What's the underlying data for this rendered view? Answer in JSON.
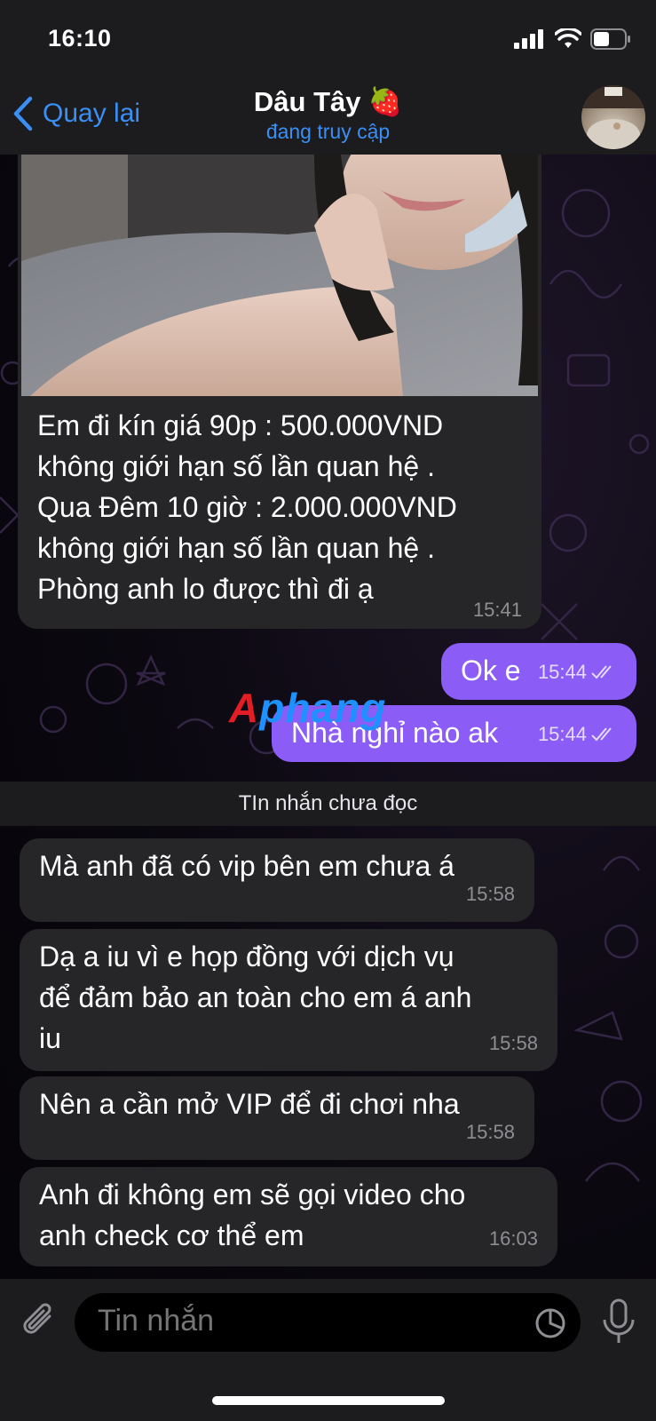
{
  "status_bar": {
    "time": "16:10"
  },
  "nav": {
    "back_label": "Quay lại",
    "title": "Dâu Tây",
    "title_emoji": "🍓",
    "subtitle": "đang truy cập"
  },
  "messages": [
    {
      "direction": "in",
      "type": "photo_caption",
      "lines": [
        "Em đi kín giá 90p  : 500.000VND",
        "không giới hạn số lần quan hệ  .",
        "Qua Đêm 10 giờ : 2.000.000VND",
        "không giới hạn số lần quan hệ .",
        "Phòng anh lo được thì đi ạ"
      ],
      "time": "15:41"
    },
    {
      "direction": "out",
      "text": "Ok e",
      "time": "15:44",
      "status": "read"
    },
    {
      "direction": "out",
      "text": "Nhà nghỉ nào ak",
      "time": "15:44",
      "status": "read"
    },
    {
      "direction": "in",
      "text": "Mà anh đã có vip bên em chưa á",
      "time": "15:58"
    },
    {
      "direction": "in",
      "lines": [
        "Dạ a iu vì e họp đồng với dịch vụ",
        "để đảm bảo an toàn cho em á anh",
        "iu"
      ],
      "time": "15:58"
    },
    {
      "direction": "in",
      "text": "Nên a cần mở VIP để đi chơi nha",
      "time": "15:58"
    },
    {
      "direction": "in",
      "lines": [
        "Anh đi không em sẽ gọi video cho",
        "anh check cơ thể em"
      ],
      "time": "16:03"
    }
  ],
  "unread_divider": "TIn nhắn chưa đọc",
  "watermark": {
    "first": "A",
    "rest": "phang"
  },
  "input": {
    "placeholder": "Tin nhắn"
  },
  "colors": {
    "accent": "#3a8ff5",
    "outgoing_bubble": "#8b5cf6",
    "incoming_bubble": "#262628",
    "bar_background": "#1c1c1e"
  }
}
